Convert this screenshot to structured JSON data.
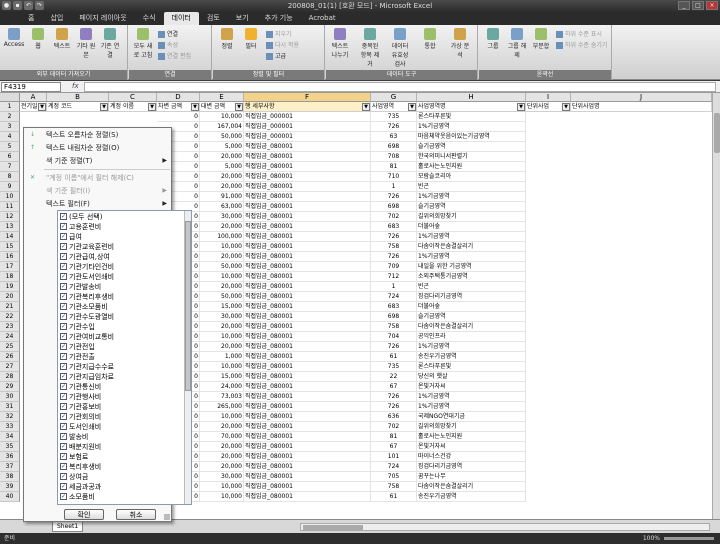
{
  "window": {
    "title": "200808_01(1) [호환 모드] - Microsoft Excel"
  },
  "tabs": [
    "홈",
    "삽입",
    "페이지 레이아웃",
    "수식",
    "데이터",
    "검토",
    "보기",
    "추가 기능",
    "Acrobat"
  ],
  "active_tab_index": 4,
  "ribbon": {
    "groups": [
      {
        "name": "외부 데이터 가져오기",
        "buttons": [
          "Access",
          "웹",
          "텍스트",
          "기타 원본",
          "기존 연결"
        ]
      },
      {
        "name": "연결",
        "buttons": [
          "모두 새로 고침",
          "연결",
          "속성",
          "연결 편집"
        ]
      },
      {
        "name": "정렬 및 필터",
        "buttons": [
          "정렬",
          "필터",
          "지우기",
          "다시 적용",
          "고급"
        ]
      },
      {
        "name": "데이터 도구",
        "buttons": [
          "텍스트 나누기",
          "중복된 항목 제거",
          "데이터 유효성 검사",
          "통합",
          "가상 분석"
        ]
      },
      {
        "name": "윤곽선",
        "buttons": [
          "그룹",
          "그룹 해제",
          "부분합",
          "하위 수준 표시",
          "하위 수준 숨기기"
        ]
      }
    ]
  },
  "formula_bar": {
    "name_box": "F4319",
    "fx": "fx",
    "formula": ""
  },
  "columns": [
    "A",
    "B",
    "C",
    "D",
    "E",
    "F",
    "G",
    "H",
    "I",
    "J"
  ],
  "header_row": [
    "전기일",
    "계정 코드",
    "계정 이름",
    "차변 금액",
    "대변 금액",
    "행 세부사항",
    "사업영역",
    "사업영역명",
    "단위사업",
    "단위사업명"
  ],
  "rows": [
    {
      "n": "2",
      "d": "0",
      "e": "10,000",
      "f": "직접입금_000001",
      "g": "735",
      "h": "론스타푸른빛"
    },
    {
      "n": "3",
      "d": "0",
      "e": "167,004",
      "f": "직접입금_000001",
      "g": "726",
      "h": "1%기금영역"
    },
    {
      "n": "4",
      "d": "0",
      "e": "50,000",
      "f": "직접입금_000001",
      "g": "63",
      "h": "마음체약웃음이있는기금영역"
    },
    {
      "n": "5",
      "d": "0",
      "e": "5,000",
      "f": "직접입금_080001",
      "g": "698",
      "h": "슬기금영역"
    },
    {
      "n": "6",
      "d": "0",
      "e": "20,000",
      "f": "직접입금_080001",
      "g": "708",
      "h": "한국의미니서판렬기"
    },
    {
      "n": "7",
      "d": "0",
      "e": "5,000",
      "f": "직접입금_080001",
      "g": "81",
      "h": "홀로사는노인지원"
    },
    {
      "n": "8",
      "d": "0",
      "e": "20,000",
      "f": "직접입금_080001",
      "g": "710",
      "h": "모람슬코리아"
    },
    {
      "n": "9",
      "d": "0",
      "e": "20,000",
      "f": "직접입금_080001",
      "g": "1",
      "h": "빈곤"
    },
    {
      "n": "10",
      "d": "0",
      "e": "91,000",
      "f": "직접입금_080001",
      "g": "726",
      "h": "1%기금영역"
    },
    {
      "n": "11",
      "d": "0",
      "e": "63,000",
      "f": "직접입금_080001",
      "g": "698",
      "h": "슬기금영역"
    },
    {
      "n": "12",
      "d": "0",
      "e": "30,000",
      "f": "직접입금_080001",
      "g": "702",
      "h": "길위의희망찾기"
    },
    {
      "n": "13",
      "d": "0",
      "e": "20,000",
      "f": "직접입금_080001",
      "g": "683",
      "h": "더불어숲"
    },
    {
      "n": "14",
      "d": "0",
      "e": "100,000",
      "f": "직접입금_080001",
      "g": "726",
      "h": "1%기금영역"
    },
    {
      "n": "15",
      "d": "0",
      "e": "10,000",
      "f": "직접입금_080001",
      "g": "758",
      "h": "다솜이작은숨결살리기"
    },
    {
      "n": "16",
      "d": "0",
      "e": "20,000",
      "f": "직접입금_080001",
      "g": "726",
      "h": "1%기금영역"
    },
    {
      "n": "17",
      "d": "0",
      "e": "50,000",
      "f": "직접입금_080001",
      "g": "709",
      "h": "내일을 위한 기금영역"
    },
    {
      "n": "18",
      "d": "0",
      "e": "10,000",
      "f": "직접입금_080001",
      "g": "712",
      "h": "소외주택통기금영역"
    },
    {
      "n": "19",
      "d": "0",
      "e": "20,000",
      "f": "직접입금_080001",
      "g": "1",
      "h": "빈곤"
    },
    {
      "n": "20",
      "d": "0",
      "e": "50,000",
      "f": "직접입금_080001",
      "g": "724",
      "h": "징검다리기금영역"
    },
    {
      "n": "21",
      "d": "0",
      "e": "15,000",
      "f": "직접입금_080001",
      "g": "683",
      "h": "더불어숲"
    },
    {
      "n": "22",
      "d": "0",
      "e": "30,000",
      "f": "직접입금_080001",
      "g": "698",
      "h": "슬기금영역"
    },
    {
      "n": "23",
      "d": "0",
      "e": "20,000",
      "f": "직접입금_080001",
      "g": "758",
      "h": "다솜이작은숨결살리기"
    },
    {
      "n": "24",
      "d": "0",
      "e": "10,000",
      "f": "직접입금_080001",
      "g": "704",
      "h": "공익인프라"
    },
    {
      "n": "25",
      "d": "0",
      "e": "20,000",
      "f": "직접입금_080001",
      "g": "726",
      "h": "1%기금영역"
    },
    {
      "n": "26",
      "d": "0",
      "e": "1,000",
      "f": "직접입금_080001",
      "g": "61",
      "h": "송진우기금영역"
    },
    {
      "n": "27",
      "d": "0",
      "e": "10,000",
      "f": "직접입금_080001",
      "g": "735",
      "h": "론스타푸른빛"
    },
    {
      "n": "28",
      "d": "0",
      "e": "15,000",
      "f": "직접입금_080001",
      "g": "22",
      "h": "당신의 햇살"
    },
    {
      "n": "29",
      "d": "0",
      "e": "24,000",
      "f": "직접입금_080001",
      "g": "67",
      "h": "온빛거자씨"
    },
    {
      "n": "30",
      "d": "0",
      "e": "73,003",
      "f": "직접입금_080001",
      "g": "726",
      "h": "1%기금영역"
    },
    {
      "n": "31",
      "d": "0",
      "e": "265,000",
      "f": "직접입금_080001",
      "g": "726",
      "h": "1%기금영역"
    },
    {
      "n": "32",
      "d": "0",
      "e": "10,000",
      "f": "직접입금_080001",
      "g": "636",
      "h": "국제NGO연대기금"
    },
    {
      "n": "33",
      "d": "0",
      "e": "20,000",
      "f": "직접입금_080001",
      "g": "702",
      "h": "길위의희망찾기"
    },
    {
      "n": "34",
      "d": "0",
      "e": "70,000",
      "f": "직접입금_080001",
      "g": "81",
      "h": "홀로사는노인지원"
    },
    {
      "n": "35",
      "d": "0",
      "e": "20,000",
      "f": "직접입금_080001",
      "g": "67",
      "h": "온빛거자씨"
    },
    {
      "n": "36",
      "d": "0",
      "e": "20,000",
      "f": "직접입금_080001",
      "g": "101",
      "h": "마이너스건강"
    },
    {
      "n": "37",
      "d": "0",
      "e": "20,000",
      "f": "직접입금_080001",
      "g": "724",
      "h": "징검다리기금영역"
    },
    {
      "n": "38",
      "d": "0",
      "e": "30,000",
      "f": "직접입금_080001",
      "g": "705",
      "h": "꿈꾸는나무"
    },
    {
      "n": "39",
      "d": "0",
      "e": "10,000",
      "f": "직접입금_080001",
      "g": "758",
      "h": "다솜이작은숨결살리기"
    },
    {
      "n": "40",
      "d": "0",
      "e": "10,000",
      "f": "직접입금_080001",
      "g": "61",
      "h": "송진우기금영역"
    }
  ],
  "filter_menu": {
    "items": [
      {
        "label": "텍스트 오름차순 정렬(S)",
        "disabled": false,
        "arrow": false,
        "icon": "sort-asc-icon"
      },
      {
        "label": "텍스트 내림차순 정렬(O)",
        "disabled": false,
        "arrow": false,
        "icon": "sort-desc-icon"
      },
      {
        "label": "색 기준 정렬(T)",
        "disabled": false,
        "arrow": true,
        "icon": ""
      },
      {
        "label": "\"계정 이름\"에서 필터 해제(C)",
        "disabled": true,
        "arrow": false,
        "icon": "clear-filter-icon"
      },
      {
        "label": "색 기준 필터(I)",
        "disabled": true,
        "arrow": true,
        "icon": ""
      },
      {
        "label": "텍스트 필터(F)",
        "disabled": false,
        "arrow": true,
        "icon": ""
      }
    ],
    "list": [
      "(모두 선택)",
      "고용훈련비",
      "급여",
      "기관교육훈련비",
      "기관급여,상여",
      "기관기타인건비",
      "기관도서인쇄비",
      "기관발송비",
      "기관복리후생비",
      "기관소모품비",
      "기관수도광열비",
      "기관수입",
      "기관여비교통비",
      "기관전입",
      "기관전출",
      "기관지급수수료",
      "기관지급임차료",
      "기관통신비",
      "기관행사비",
      "기관홍보비",
      "기관회의비",
      "도서인쇄비",
      "발송비",
      "배분지원비",
      "보험료",
      "복리후생비",
      "상여금",
      "세금과공과",
      "소모품비"
    ],
    "ok": "확인",
    "cancel": "취소"
  },
  "sheet_tab": "Sheet1",
  "status": {
    "ready": "준비",
    "zoom": "100%"
  }
}
